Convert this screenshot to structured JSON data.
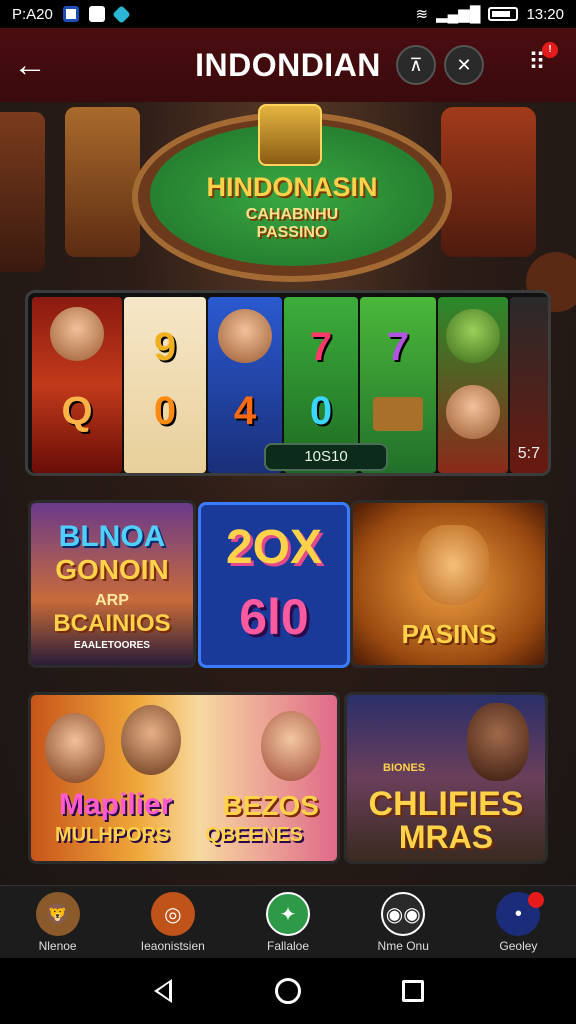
{
  "status_bar": {
    "left_text": "P:A20",
    "right_text": "13:20"
  },
  "header": {
    "title": "INDONDIAN",
    "menu_badge": "!"
  },
  "hero": {
    "line1": "HINDONASIN",
    "line2": "CAHABNHU",
    "line3": "PASSINO"
  },
  "slot_banner": {
    "counter": "10S10",
    "corner": "5:7",
    "symbols": [
      "Q",
      "9",
      "0",
      "4",
      "7",
      "0",
      "7"
    ]
  },
  "tiles": [
    {
      "lines": [
        "BLNOA",
        "GONOIN",
        "ARP",
        "BCAINIOS",
        "EAALETOORES"
      ]
    },
    {
      "lines": [
        "2OX",
        "6l0"
      ]
    },
    {
      "lines": [
        "PASINS"
      ]
    },
    {
      "lines": [
        "Mapilier",
        "BEZOS",
        "MULHPORS",
        "QBEENES"
      ]
    },
    {
      "lines": [
        "CHLIFIES",
        "MRAS",
        "BIONES"
      ]
    }
  ],
  "bottom_nav": [
    {
      "label": "Nlenoe",
      "icon": "lion-mascot-icon",
      "color": "#8a5a2a"
    },
    {
      "label": "Ieaonistsien",
      "icon": "casino-chip-icon",
      "color": "#c0531a"
    },
    {
      "label": "Fallaloe",
      "icon": "game-controller-icon",
      "color": "#2c9a46"
    },
    {
      "label": "Nme Onu",
      "icon": "gamepad-icon",
      "color": "#2a2a2a"
    },
    {
      "label": "Geoley",
      "icon": "profile-icon",
      "color": "#1b2c7a"
    }
  ],
  "colors": {
    "header_bg": "#4a0d10",
    "accent_gold": "#ffd24a",
    "badge_red": "#e51a1a"
  }
}
